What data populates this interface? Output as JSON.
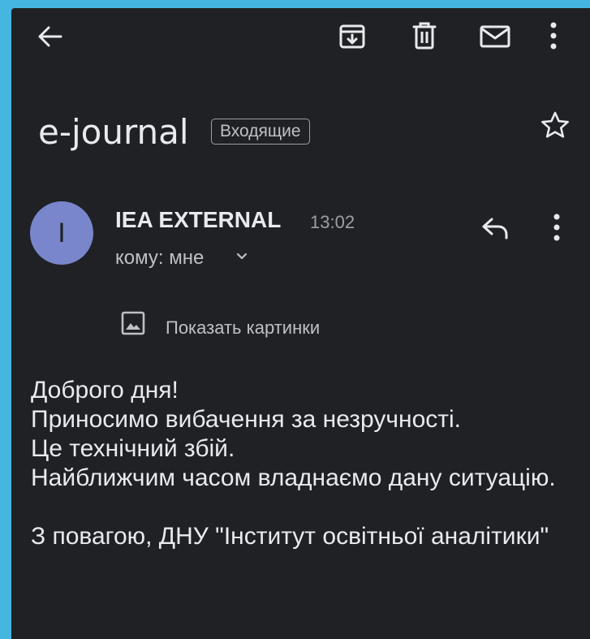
{
  "toolbar": {
    "back_icon": "arrow-back-icon",
    "archive_icon": "archive-icon",
    "delete_icon": "trash-icon",
    "mark_unread_icon": "mail-icon",
    "more_icon": "more-vert-icon"
  },
  "message": {
    "subject": "e-journal",
    "label": "Входящие",
    "sender": {
      "initial": "I",
      "name": "IEA EXTERNAL",
      "time": "13:02",
      "recipient": "кому: мне"
    },
    "show_images_label": "Показать картинки",
    "body": {
      "line1": "Доброго дня!",
      "line2": "Приносимо вибачення за незручності.",
      "line3": "Це технічний збій.",
      "line4": "Найближчим часом владнаємо дану ситуацію.",
      "line5": "З повагою, ДНУ \"Інститут освітньої аналітики\""
    }
  },
  "colors": {
    "background": "#202124",
    "frame": "#45b6e0",
    "avatar": "#7986cb",
    "text": "#e8eaed",
    "muted": "#9aa0a6"
  }
}
